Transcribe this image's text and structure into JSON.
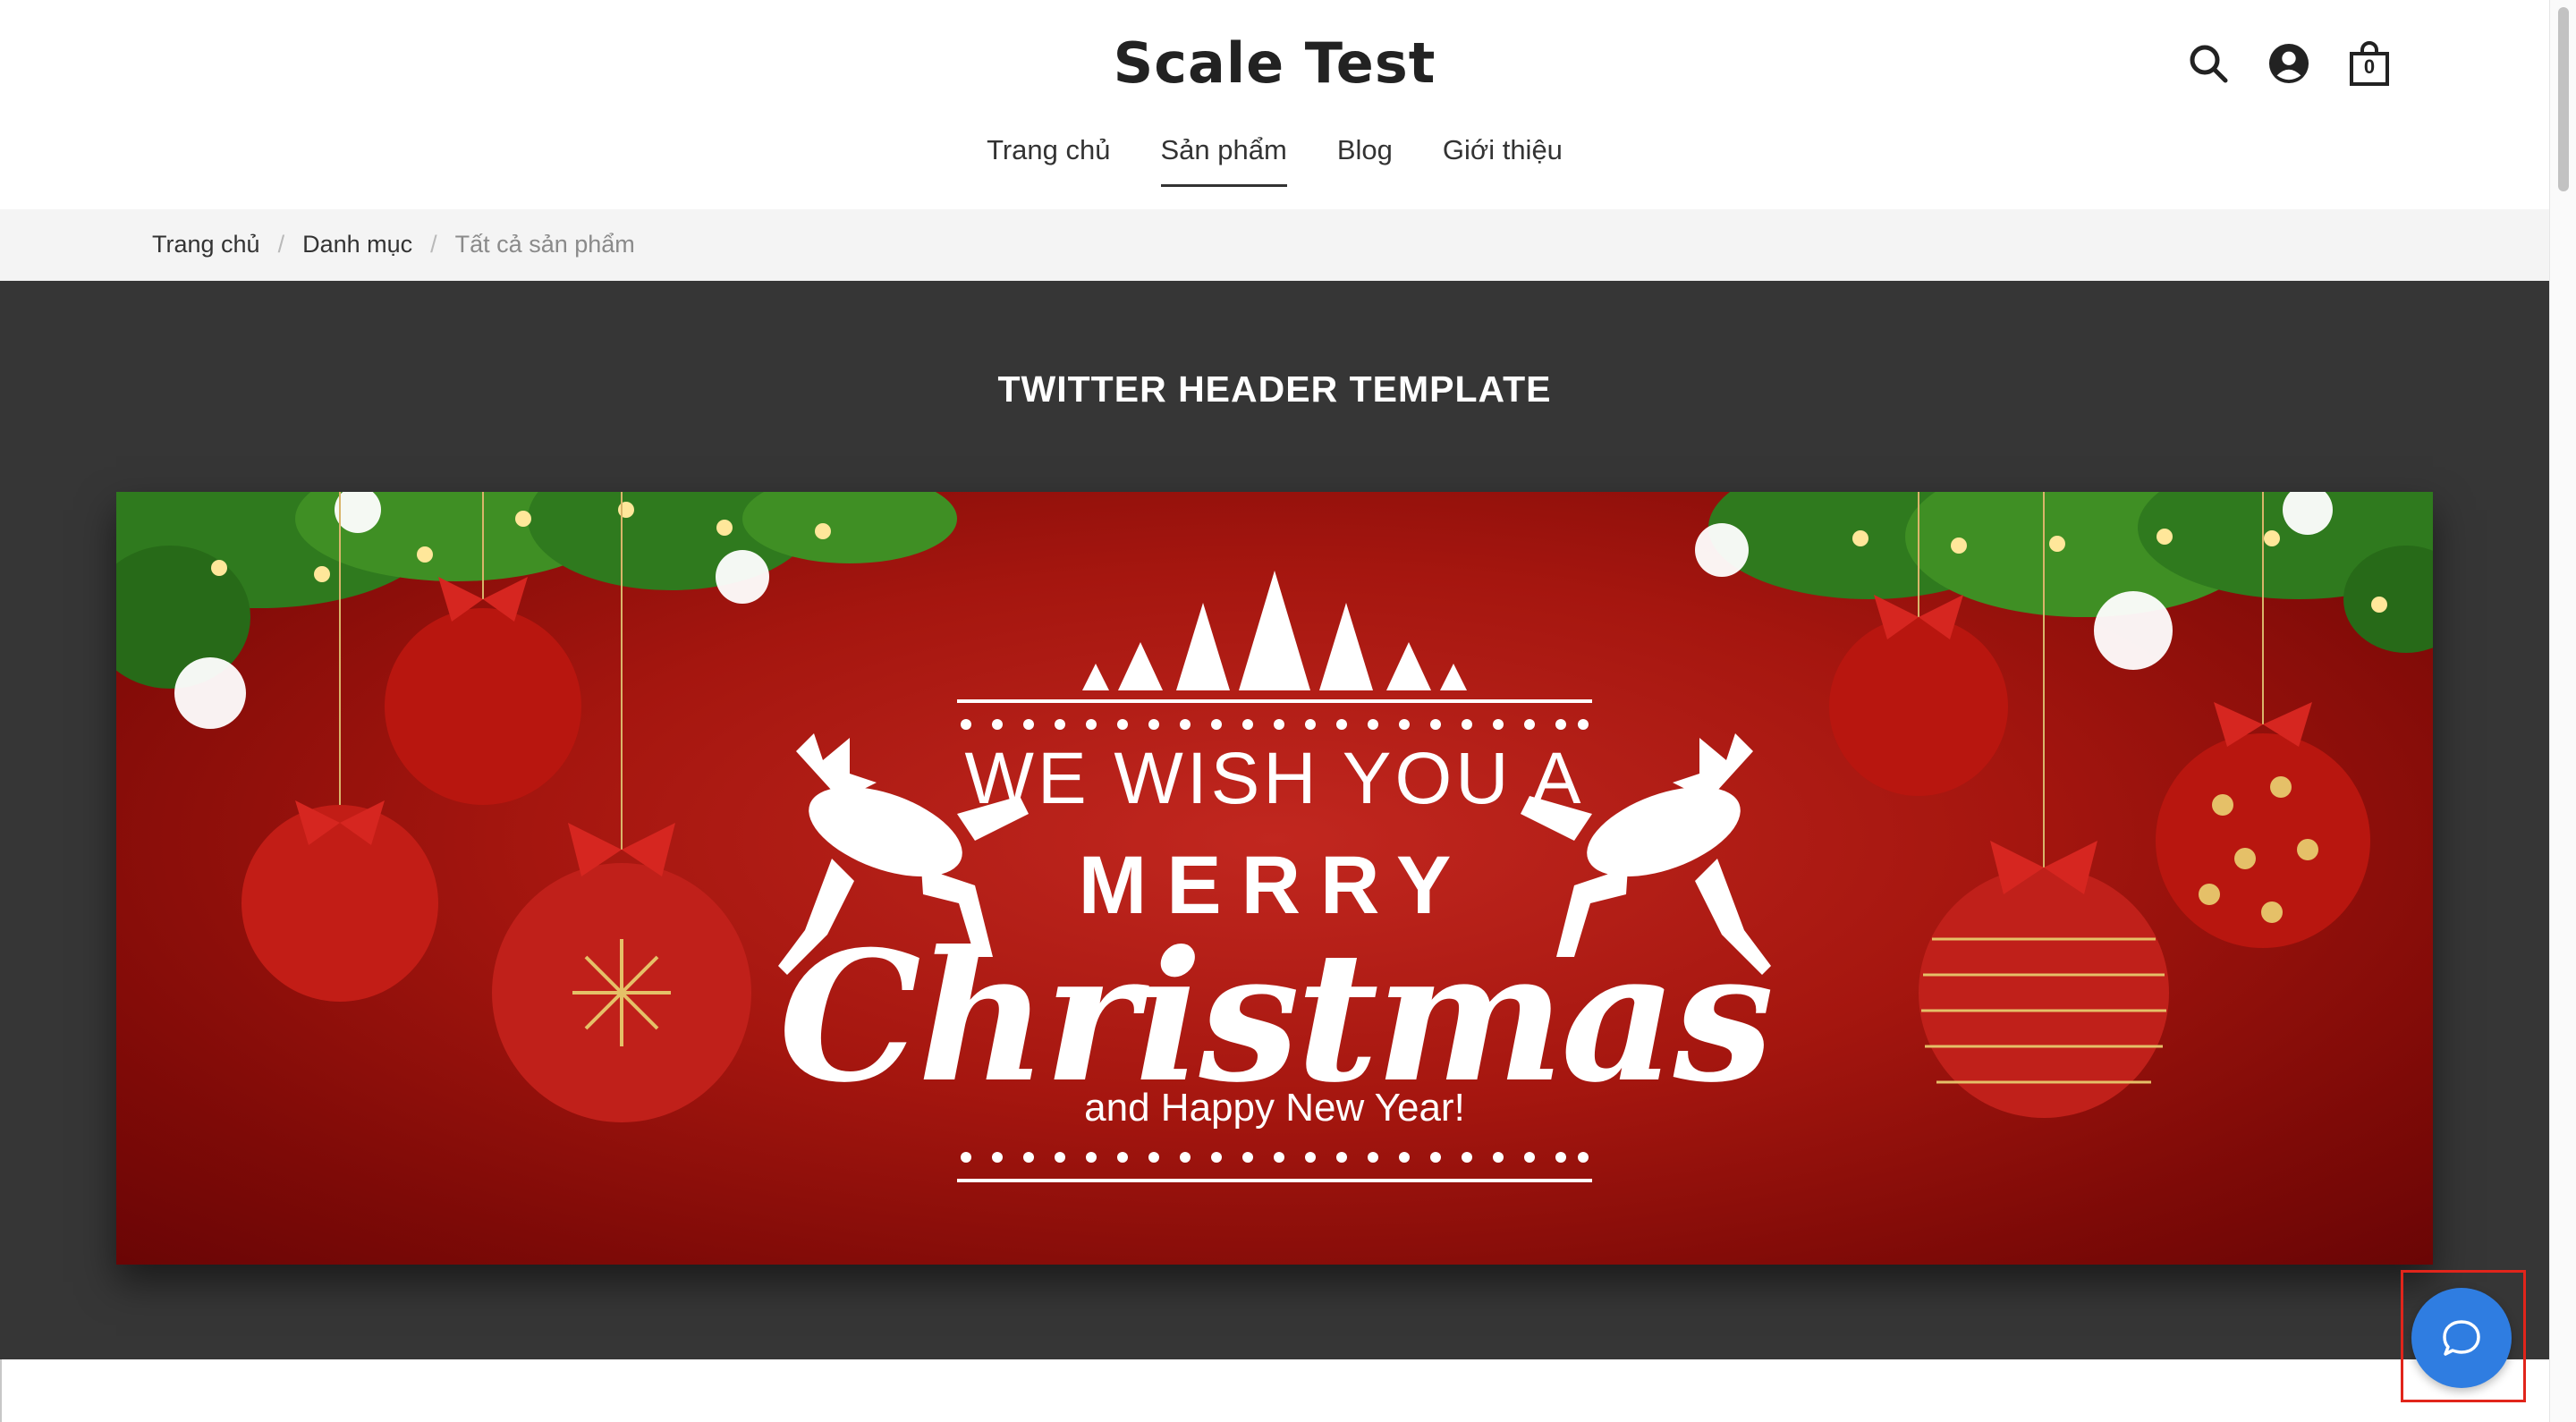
{
  "site": {
    "title": "Scale Test"
  },
  "header": {
    "cart_count": "0"
  },
  "nav": {
    "items": [
      {
        "label": "Trang chủ"
      },
      {
        "label": "Sản phẩm"
      },
      {
        "label": "Blog"
      },
      {
        "label": "Giới thiệu"
      }
    ],
    "active_index": 1
  },
  "breadcrumb": {
    "items": [
      {
        "label": "Trang chủ"
      },
      {
        "label": "Danh mục"
      },
      {
        "label": "Tất cả sản phẩm"
      }
    ],
    "separator": "/"
  },
  "product": {
    "title": "TWITTER HEADER TEMPLATE",
    "banner": {
      "line1": "WE WISH YOU A",
      "line2": "MERRY",
      "line3": "Christmas",
      "line4": "and Happy New Year!"
    }
  },
  "colors": {
    "accent_chat": "#2f7de1",
    "section_bg": "#363636",
    "banner_red": "#a5160f",
    "highlight": "#e1251b"
  },
  "icons": [
    "search-icon",
    "account-icon",
    "cart-icon",
    "chat-icon"
  ]
}
